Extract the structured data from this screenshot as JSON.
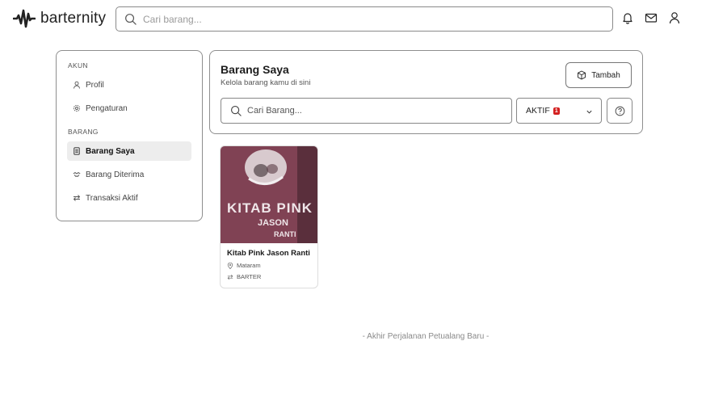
{
  "header": {
    "brand": "barternity",
    "search_placeholder": "Cari barang...",
    "icons": [
      "bell-icon",
      "mail-icon",
      "user-icon"
    ]
  },
  "sidebar": {
    "sections": [
      {
        "label": "AKUN",
        "items": [
          {
            "label": "Profil",
            "icon": "user-icon"
          },
          {
            "label": "Pengaturan",
            "icon": "gear-icon"
          }
        ]
      },
      {
        "label": "BARANG",
        "items": [
          {
            "label": "Barang Saya",
            "icon": "document-icon",
            "active": true
          },
          {
            "label": "Barang Diterima",
            "icon": "handshake-icon"
          },
          {
            "label": "Transaksi Aktif",
            "icon": "swap-icon"
          }
        ]
      }
    ]
  },
  "main": {
    "title": "Barang Saya",
    "subtitle": "Kelola barang kamu di sini",
    "add_button_label": "Tambah",
    "search_placeholder": "Cari Barang...",
    "filter": {
      "selected": "AKTIF",
      "badge": "1"
    }
  },
  "items": [
    {
      "title": "Kitab Pink Jason Ranti",
      "location": "Mataram",
      "type": "BARTER",
      "cover_text": [
        "KITAB PINK",
        "JASON",
        "RANTI"
      ]
    }
  ],
  "footer_note": "- Akhir Perjalanan Petualang Baru -",
  "colors": {
    "border": "#8e8e8e",
    "active_bg": "#ededed",
    "badge": "#d32020",
    "cover": "#8a4a5c"
  }
}
